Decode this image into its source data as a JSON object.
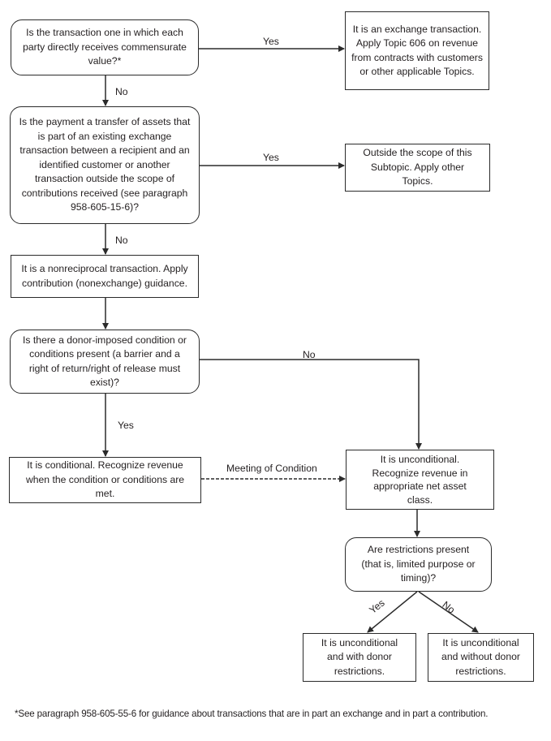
{
  "nodes": {
    "q1": "Is the transaction one in which each party directly receives commensurate value?*",
    "exchange": "It is an exchange transaction. Apply Topic 606 on revenue from contracts with customers or other applicable Topics.",
    "q2": "Is the payment a transfer of assets that is part of an existing exchange transaction between a recipient and an identified customer or another transaction outside the scope of contributions received (see paragraph 958-605-15-6)?",
    "outside_scope": "Outside the scope of this Subtopic. Apply other Topics.",
    "nonreciprocal": "It is a nonreciprocal transaction. Apply contribution (nonexchange) guidance.",
    "q3": "Is there a donor-imposed condition or conditions present (a barrier and a right of return/right of release must exist)?",
    "conditional": "It is conditional. Recognize revenue when the condition or conditions are met.",
    "unconditional": "It is unconditional. Recognize revenue in appropriate net asset class.",
    "q4": "Are restrictions present (that is, limited purpose or timing)?",
    "with_restrictions": "It is unconditional and with donor restrictions.",
    "without_restrictions": "It is unconditional and without donor restrictions."
  },
  "edge_labels": {
    "q1_yes": "Yes",
    "q1_no": "No",
    "q2_yes": "Yes",
    "q2_no": "No",
    "q3_no": "No",
    "q3_yes": "Yes",
    "meeting": "Meeting of Condition",
    "q4_yes": "Yes",
    "q4_no": "No"
  },
  "footnote": "*See paragraph 958-605-55-6 for guidance about transactions that are in part an exchange and in part a contribution."
}
